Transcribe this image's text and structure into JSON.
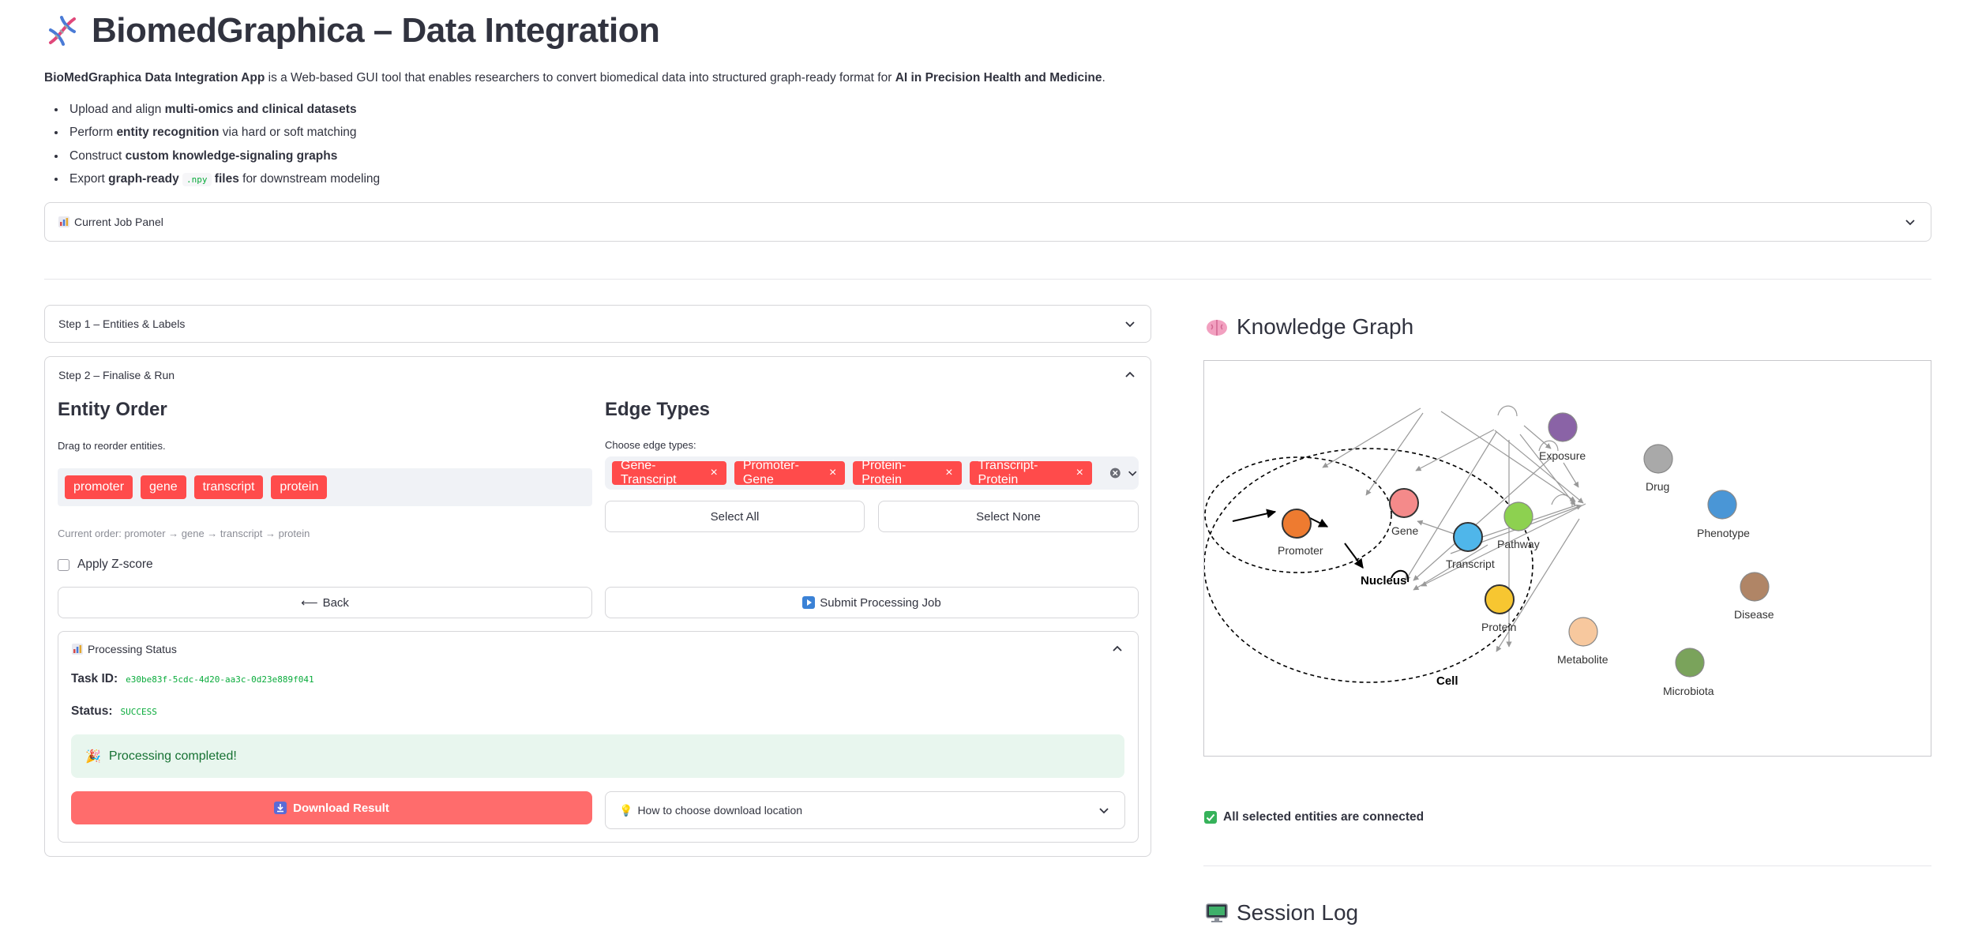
{
  "header": {
    "title": "BiomedGraphica – Data Integration",
    "intro_bold": "BioMedGraphica Data Integration App",
    "intro_text": " is a Web-based GUI tool that enables researchers to convert biomedical data into structured graph-ready format for ",
    "intro_bold2": "AI in Precision Health and Medicine",
    "intro_end": "."
  },
  "features": [
    {
      "pre": "Upload and align ",
      "bold": "multi-omics and clinical datasets",
      "code": "",
      "post": ""
    },
    {
      "pre": "Perform ",
      "bold": "entity recognition",
      "code": "",
      "post": " via hard or soft matching"
    },
    {
      "pre": "Construct ",
      "bold": "custom knowledge-signaling graphs",
      "code": "",
      "post": ""
    },
    {
      "pre": "Export ",
      "bold": "graph-ready ",
      "code": ".npy",
      "bold2": " files",
      "post": " for downstream modeling"
    }
  ],
  "current_job_panel": "Current Job Panel",
  "step1": {
    "label": "Step 1 – Entities & Labels"
  },
  "step2": {
    "label": "Step 2 – Finalise & Run",
    "entity_order": {
      "heading": "Entity Order",
      "hint": "Drag to reorder entities.",
      "items": [
        "promoter",
        "gene",
        "transcript",
        "protein"
      ],
      "current_order": "Current order: promoter → gene → transcript → protein"
    },
    "edge_types": {
      "heading": "Edge Types",
      "hint": "Choose edge types:",
      "selected": [
        "Gene-Transcript",
        "Promoter-Gene",
        "Protein-Protein",
        "Transcript-Protein"
      ],
      "select_all": "Select All",
      "select_none": "Select None"
    },
    "zscore_label": "Apply Z-score",
    "zscore_checked": false,
    "back_label": "Back",
    "submit_label": "Submit Processing Job",
    "processing": {
      "heading": "Processing Status",
      "task_id_label": "Task ID:",
      "task_id": "e30be83f-5cdc-4d20-aa3c-0d23e889f041",
      "status_label": "Status:",
      "status": "SUCCESS",
      "completed": "Processing completed!",
      "download": "Download Result",
      "download_help": "How to choose download location"
    }
  },
  "knowledge_graph": {
    "heading": "Knowledge Graph",
    "nodes": [
      "Promoter",
      "Gene",
      "Transcript",
      "Protein",
      "Pathway",
      "Exposure",
      "Drug",
      "Phenotype",
      "Disease",
      "Metabolite",
      "Microbiota"
    ],
    "regions": [
      "Nucleus",
      "Cell"
    ],
    "colors": {
      "Promoter": "#ee7b30",
      "Gene": "#f48a8a",
      "Transcript": "#4fb6ea",
      "Protein": "#f7c631",
      "Pathway": "#8dd150",
      "Exposure": "#8a63a6",
      "Drug": "#a9a9a9",
      "Phenotype": "#4a96d6",
      "Disease": "#b08566",
      "Metabolite": "#f7c89e",
      "Microbiota": "#7aa35b"
    },
    "connected_msg": "All selected entities are connected"
  },
  "session_log": {
    "heading": "Session Log"
  }
}
